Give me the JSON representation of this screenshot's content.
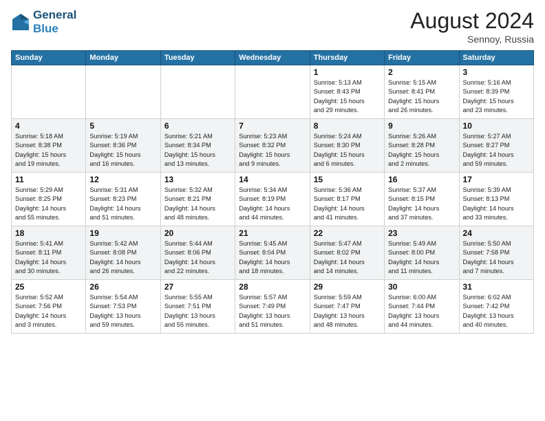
{
  "header": {
    "logo_line1": "General",
    "logo_line2": "Blue",
    "month_title": "August 2024",
    "location": "Sennoy, Russia"
  },
  "weekdays": [
    "Sunday",
    "Monday",
    "Tuesday",
    "Wednesday",
    "Thursday",
    "Friday",
    "Saturday"
  ],
  "weeks": [
    [
      {
        "day": "",
        "detail": ""
      },
      {
        "day": "",
        "detail": ""
      },
      {
        "day": "",
        "detail": ""
      },
      {
        "day": "",
        "detail": ""
      },
      {
        "day": "1",
        "detail": "Sunrise: 5:13 AM\nSunset: 8:43 PM\nDaylight: 15 hours\nand 29 minutes."
      },
      {
        "day": "2",
        "detail": "Sunrise: 5:15 AM\nSunset: 8:41 PM\nDaylight: 15 hours\nand 26 minutes."
      },
      {
        "day": "3",
        "detail": "Sunrise: 5:16 AM\nSunset: 8:39 PM\nDaylight: 15 hours\nand 23 minutes."
      }
    ],
    [
      {
        "day": "4",
        "detail": "Sunrise: 5:18 AM\nSunset: 8:38 PM\nDaylight: 15 hours\nand 19 minutes."
      },
      {
        "day": "5",
        "detail": "Sunrise: 5:19 AM\nSunset: 8:36 PM\nDaylight: 15 hours\nand 16 minutes."
      },
      {
        "day": "6",
        "detail": "Sunrise: 5:21 AM\nSunset: 8:34 PM\nDaylight: 15 hours\nand 13 minutes."
      },
      {
        "day": "7",
        "detail": "Sunrise: 5:23 AM\nSunset: 8:32 PM\nDaylight: 15 hours\nand 9 minutes."
      },
      {
        "day": "8",
        "detail": "Sunrise: 5:24 AM\nSunset: 8:30 PM\nDaylight: 15 hours\nand 6 minutes."
      },
      {
        "day": "9",
        "detail": "Sunrise: 5:26 AM\nSunset: 8:28 PM\nDaylight: 15 hours\nand 2 minutes."
      },
      {
        "day": "10",
        "detail": "Sunrise: 5:27 AM\nSunset: 8:27 PM\nDaylight: 14 hours\nand 59 minutes."
      }
    ],
    [
      {
        "day": "11",
        "detail": "Sunrise: 5:29 AM\nSunset: 8:25 PM\nDaylight: 14 hours\nand 55 minutes."
      },
      {
        "day": "12",
        "detail": "Sunrise: 5:31 AM\nSunset: 8:23 PM\nDaylight: 14 hours\nand 51 minutes."
      },
      {
        "day": "13",
        "detail": "Sunrise: 5:32 AM\nSunset: 8:21 PM\nDaylight: 14 hours\nand 48 minutes."
      },
      {
        "day": "14",
        "detail": "Sunrise: 5:34 AM\nSunset: 8:19 PM\nDaylight: 14 hours\nand 44 minutes."
      },
      {
        "day": "15",
        "detail": "Sunrise: 5:36 AM\nSunset: 8:17 PM\nDaylight: 14 hours\nand 41 minutes."
      },
      {
        "day": "16",
        "detail": "Sunrise: 5:37 AM\nSunset: 8:15 PM\nDaylight: 14 hours\nand 37 minutes."
      },
      {
        "day": "17",
        "detail": "Sunrise: 5:39 AM\nSunset: 8:13 PM\nDaylight: 14 hours\nand 33 minutes."
      }
    ],
    [
      {
        "day": "18",
        "detail": "Sunrise: 5:41 AM\nSunset: 8:11 PM\nDaylight: 14 hours\nand 30 minutes."
      },
      {
        "day": "19",
        "detail": "Sunrise: 5:42 AM\nSunset: 8:08 PM\nDaylight: 14 hours\nand 26 minutes."
      },
      {
        "day": "20",
        "detail": "Sunrise: 5:44 AM\nSunset: 8:06 PM\nDaylight: 14 hours\nand 22 minutes."
      },
      {
        "day": "21",
        "detail": "Sunrise: 5:45 AM\nSunset: 8:04 PM\nDaylight: 14 hours\nand 18 minutes."
      },
      {
        "day": "22",
        "detail": "Sunrise: 5:47 AM\nSunset: 8:02 PM\nDaylight: 14 hours\nand 14 minutes."
      },
      {
        "day": "23",
        "detail": "Sunrise: 5:49 AM\nSunset: 8:00 PM\nDaylight: 14 hours\nand 11 minutes."
      },
      {
        "day": "24",
        "detail": "Sunrise: 5:50 AM\nSunset: 7:58 PM\nDaylight: 14 hours\nand 7 minutes."
      }
    ],
    [
      {
        "day": "25",
        "detail": "Sunrise: 5:52 AM\nSunset: 7:56 PM\nDaylight: 14 hours\nand 3 minutes."
      },
      {
        "day": "26",
        "detail": "Sunrise: 5:54 AM\nSunset: 7:53 PM\nDaylight: 13 hours\nand 59 minutes."
      },
      {
        "day": "27",
        "detail": "Sunrise: 5:55 AM\nSunset: 7:51 PM\nDaylight: 13 hours\nand 55 minutes."
      },
      {
        "day": "28",
        "detail": "Sunrise: 5:57 AM\nSunset: 7:49 PM\nDaylight: 13 hours\nand 51 minutes."
      },
      {
        "day": "29",
        "detail": "Sunrise: 5:59 AM\nSunset: 7:47 PM\nDaylight: 13 hours\nand 48 minutes."
      },
      {
        "day": "30",
        "detail": "Sunrise: 6:00 AM\nSunset: 7:44 PM\nDaylight: 13 hours\nand 44 minutes."
      },
      {
        "day": "31",
        "detail": "Sunrise: 6:02 AM\nSunset: 7:42 PM\nDaylight: 13 hours\nand 40 minutes."
      }
    ]
  ]
}
